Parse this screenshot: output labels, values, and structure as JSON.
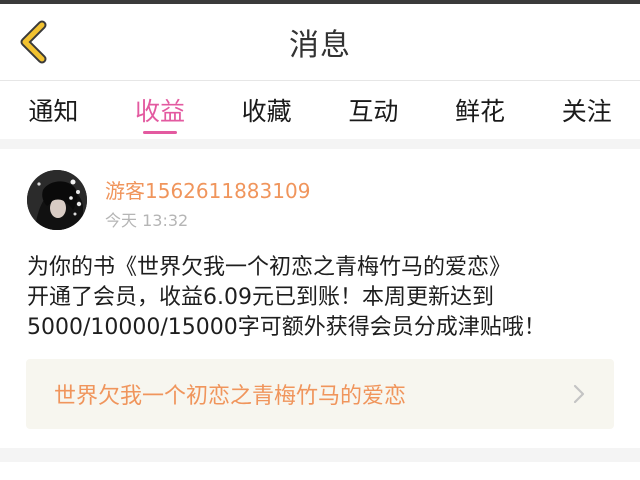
{
  "header": {
    "title": "消息",
    "back_icon": "chevron-left-icon",
    "back_icon_color": "#f2c230"
  },
  "tabs": [
    {
      "label": "通知",
      "active": false
    },
    {
      "label": "收益",
      "active": true
    },
    {
      "label": "收藏",
      "active": false
    },
    {
      "label": "互动",
      "active": false
    },
    {
      "label": "鲜花",
      "active": false
    },
    {
      "label": "关注",
      "active": false
    }
  ],
  "colors": {
    "accent": "#e35aa0",
    "highlight": "#f0955c",
    "muted": "#b5b5b5"
  },
  "message": {
    "username": "游客1562611883109",
    "time": "今天 13:32",
    "body_lines": [
      "为你的书《世界欠我一个初恋之青梅竹马的爱恋》",
      "开通了会员，收益6.09元已到账！本周更新达到",
      "5000/10000/15000字可额外获得会员分成津贴哦！"
    ],
    "book_link_title": "世界欠我一个初恋之青梅竹马的爱恋",
    "book_link_icon": "chevron-right-icon"
  }
}
